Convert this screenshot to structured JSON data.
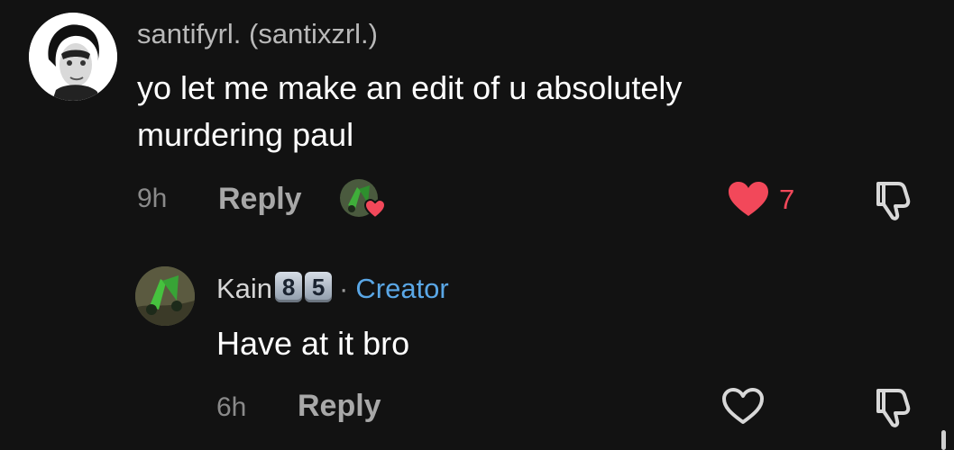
{
  "comment": {
    "username": "santifyrl. (santixzrl.)",
    "text_line1": "yo let me make an edit of u absolutely",
    "text_line2": "murdering paul",
    "time": "9h",
    "reply_label": "Reply",
    "like_count": "7",
    "liked": true,
    "icons": {
      "avatar": "profile-photo",
      "creator_liked": "creator-avatar-with-heart",
      "like": "heart-filled-icon",
      "dislike": "thumbs-down-icon"
    }
  },
  "reply": {
    "username": "Kain",
    "badge_digits": [
      "8",
      "5"
    ],
    "separator": "·",
    "creator_label": "Creator",
    "text": "Have at it bro",
    "time": "6h",
    "reply_label": "Reply",
    "icons": {
      "avatar": "profile-photo",
      "like": "heart-outline-icon",
      "dislike": "thumbs-down-icon"
    }
  },
  "colors": {
    "background": "#121212",
    "like_red": "#f2485a",
    "creator_blue": "#5aa7e6"
  }
}
